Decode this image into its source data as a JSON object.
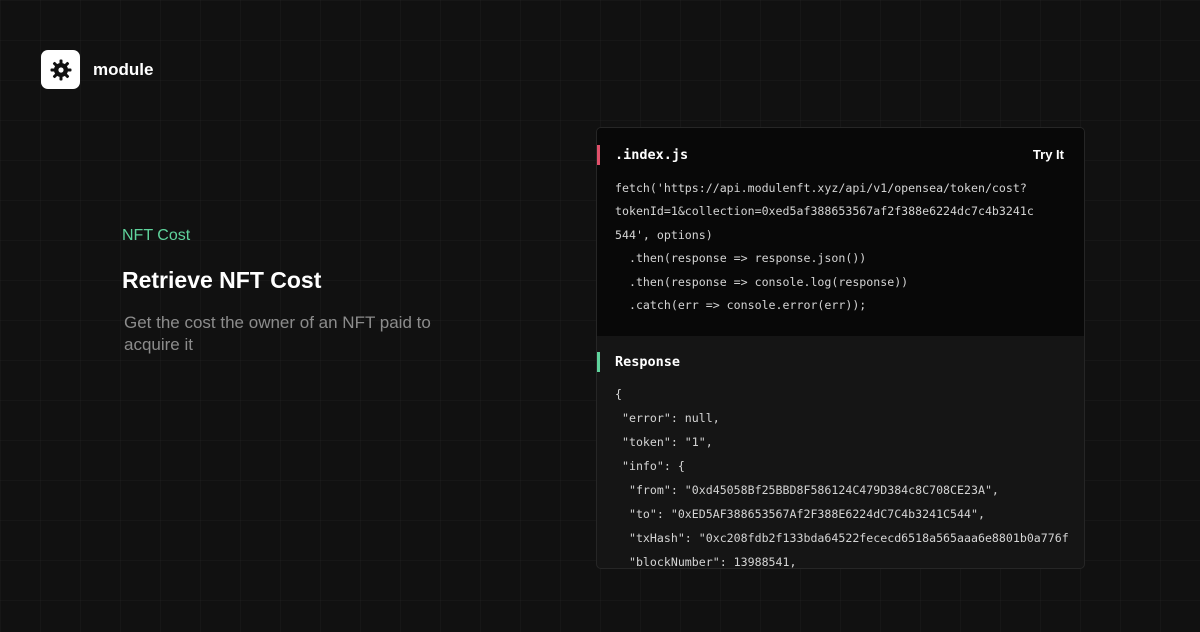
{
  "brand": {
    "name": "module",
    "icon": "gear-icon"
  },
  "hero": {
    "eyebrow": "NFT Cost",
    "title": "Retrieve NFT Cost",
    "description": "Get the cost the owner of an NFT paid to acquire it"
  },
  "code_panel": {
    "filename": ".index.js",
    "try_label": "Try It",
    "lines": [
      "fetch('https://api.modulenft.xyz/api/v1/opensea/token/cost?",
      "tokenId=1&collection=0xed5af388653567af2f388e6224dc7c4b3241c",
      "544', options)",
      "  .then(response => response.json())",
      "  .then(response => console.log(response))",
      "  .catch(err => console.error(err));"
    ]
  },
  "response_panel": {
    "title": "Response",
    "lines": [
      "{",
      " \"error\": null,",
      " \"token\": \"1\",",
      " \"info\": {",
      "  \"from\": \"0xd45058Bf25BBD8F586124C479D384c8C708CE23A\",",
      "  \"to\": \"0xED5AF388653567Af2F388E6224dC7C4b3241C544\",",
      "  \"txHash\": \"0xc208fdb2f133bda64522fececd6518a565aaa6e8801b0a776f",
      "  \"blockNumber\": 13988541,"
    ]
  },
  "colors": {
    "accent_green": "#5fd39c",
    "accent_red": "#e0506a",
    "background": "#111111"
  }
}
